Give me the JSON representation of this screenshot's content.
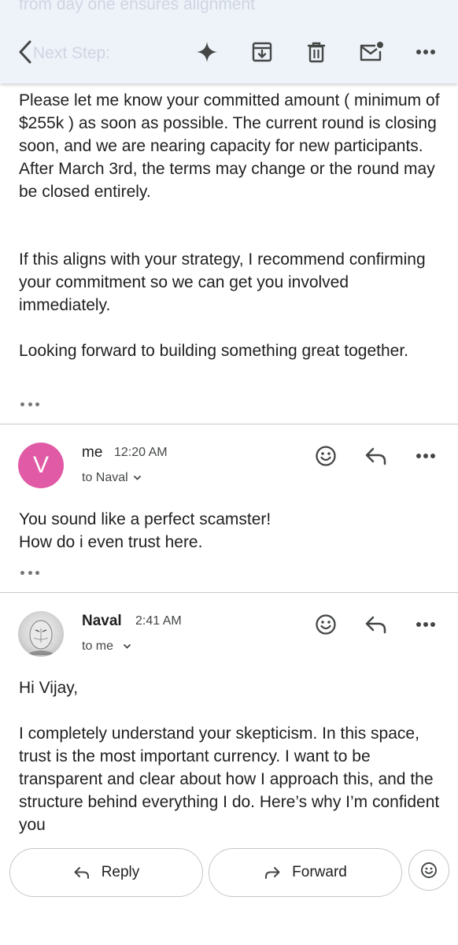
{
  "toolbar": {
    "ghost_top": "from day one ensures alignment",
    "ghost_next": "Next Step:",
    "actions": [
      "back-arrow-icon",
      "sparkle-icon",
      "archive-icon",
      "trash-icon",
      "mark-unread-icon",
      "more-icon"
    ]
  },
  "message1": {
    "paragraphs": [
      "Please let me know your committed amount ( minimum of $255k ) as soon as possible. The current round is closing soon, and we are nearing capacity for new participants. After March 3rd, the terms may change or the round may be closed entirely.",
      "If this aligns with your strategy, I recommend confirming your commitment so we can get you involved immediately.",
      "Looking forward to building something great together."
    ]
  },
  "message2": {
    "avatar_letter": "V",
    "avatar_color": "#e05aa5",
    "sender": "me",
    "time": "12:20 AM",
    "to": "to Naval",
    "body_lines": [
      "You sound like a perfect scamster!",
      "How do i even trust here."
    ]
  },
  "message3": {
    "sender": "Naval",
    "time": "2:41 AM",
    "to": "to me",
    "greeting": "Hi Vijay,",
    "body": "I completely understand your skepticism. In this space, trust is the most important currency. I want to be transparent and clear about how I approach this, and the structure behind everything I do. Here’s why I’m confident you"
  },
  "bottom": {
    "reply_label": "Reply",
    "forward_label": "Forward"
  },
  "colors": {
    "toolbar_bg": "#eef2f9",
    "icon": "#444746"
  }
}
